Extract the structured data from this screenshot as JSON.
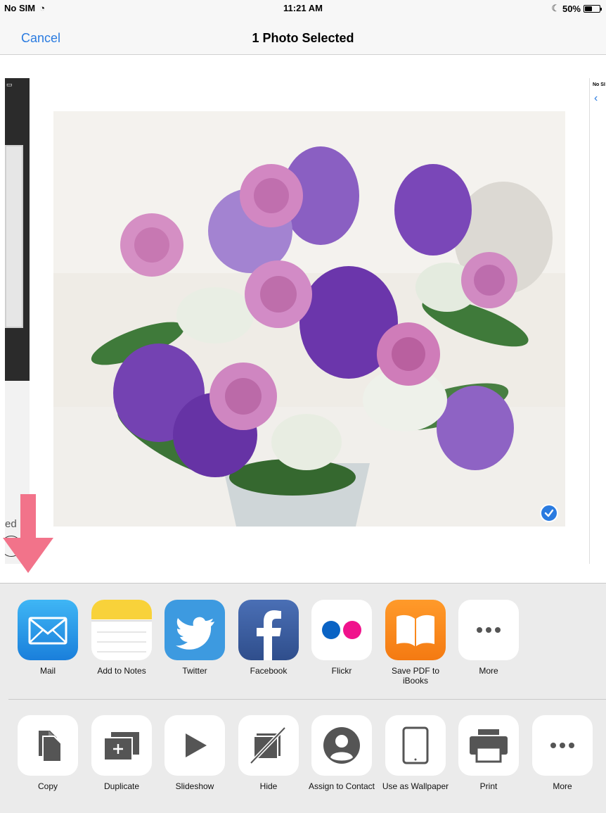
{
  "status_bar": {
    "carrier": "No SIM",
    "time": "11:21 AM",
    "battery": "50%",
    "battery_level": 0.5
  },
  "nav": {
    "cancel_label": "Cancel",
    "title": "1 Photo Selected"
  },
  "side_photo_left": {
    "label": "ed"
  },
  "side_photo_right": {
    "carrier": "No SI"
  },
  "apps": [
    {
      "label": "Mail",
      "icon": "mail-icon"
    },
    {
      "label": "Add to Notes",
      "icon": "notes-icon"
    },
    {
      "label": "Twitter",
      "icon": "twitter-icon"
    },
    {
      "label": "Facebook",
      "icon": "facebook-icon"
    },
    {
      "label": "Flickr",
      "icon": "flickr-icon"
    },
    {
      "label": "Save PDF to iBooks",
      "icon": "ibooks-icon"
    },
    {
      "label": "More",
      "icon": "more-icon"
    }
  ],
  "actions": [
    {
      "label": "Copy",
      "icon": "copy-icon"
    },
    {
      "label": "Duplicate",
      "icon": "duplicate-icon"
    },
    {
      "label": "Slideshow",
      "icon": "play-icon"
    },
    {
      "label": "Hide",
      "icon": "hide-icon"
    },
    {
      "label": "Assign to Contact",
      "icon": "contact-icon"
    },
    {
      "label": "Use as Wallpaper",
      "icon": "ipad-icon"
    },
    {
      "label": "Print",
      "icon": "printer-icon"
    },
    {
      "label": "More",
      "icon": "more-icon"
    }
  ],
  "colors": {
    "accent": "#2a7be0",
    "arrow": "#f2738a",
    "panel": "#ebebeb"
  }
}
